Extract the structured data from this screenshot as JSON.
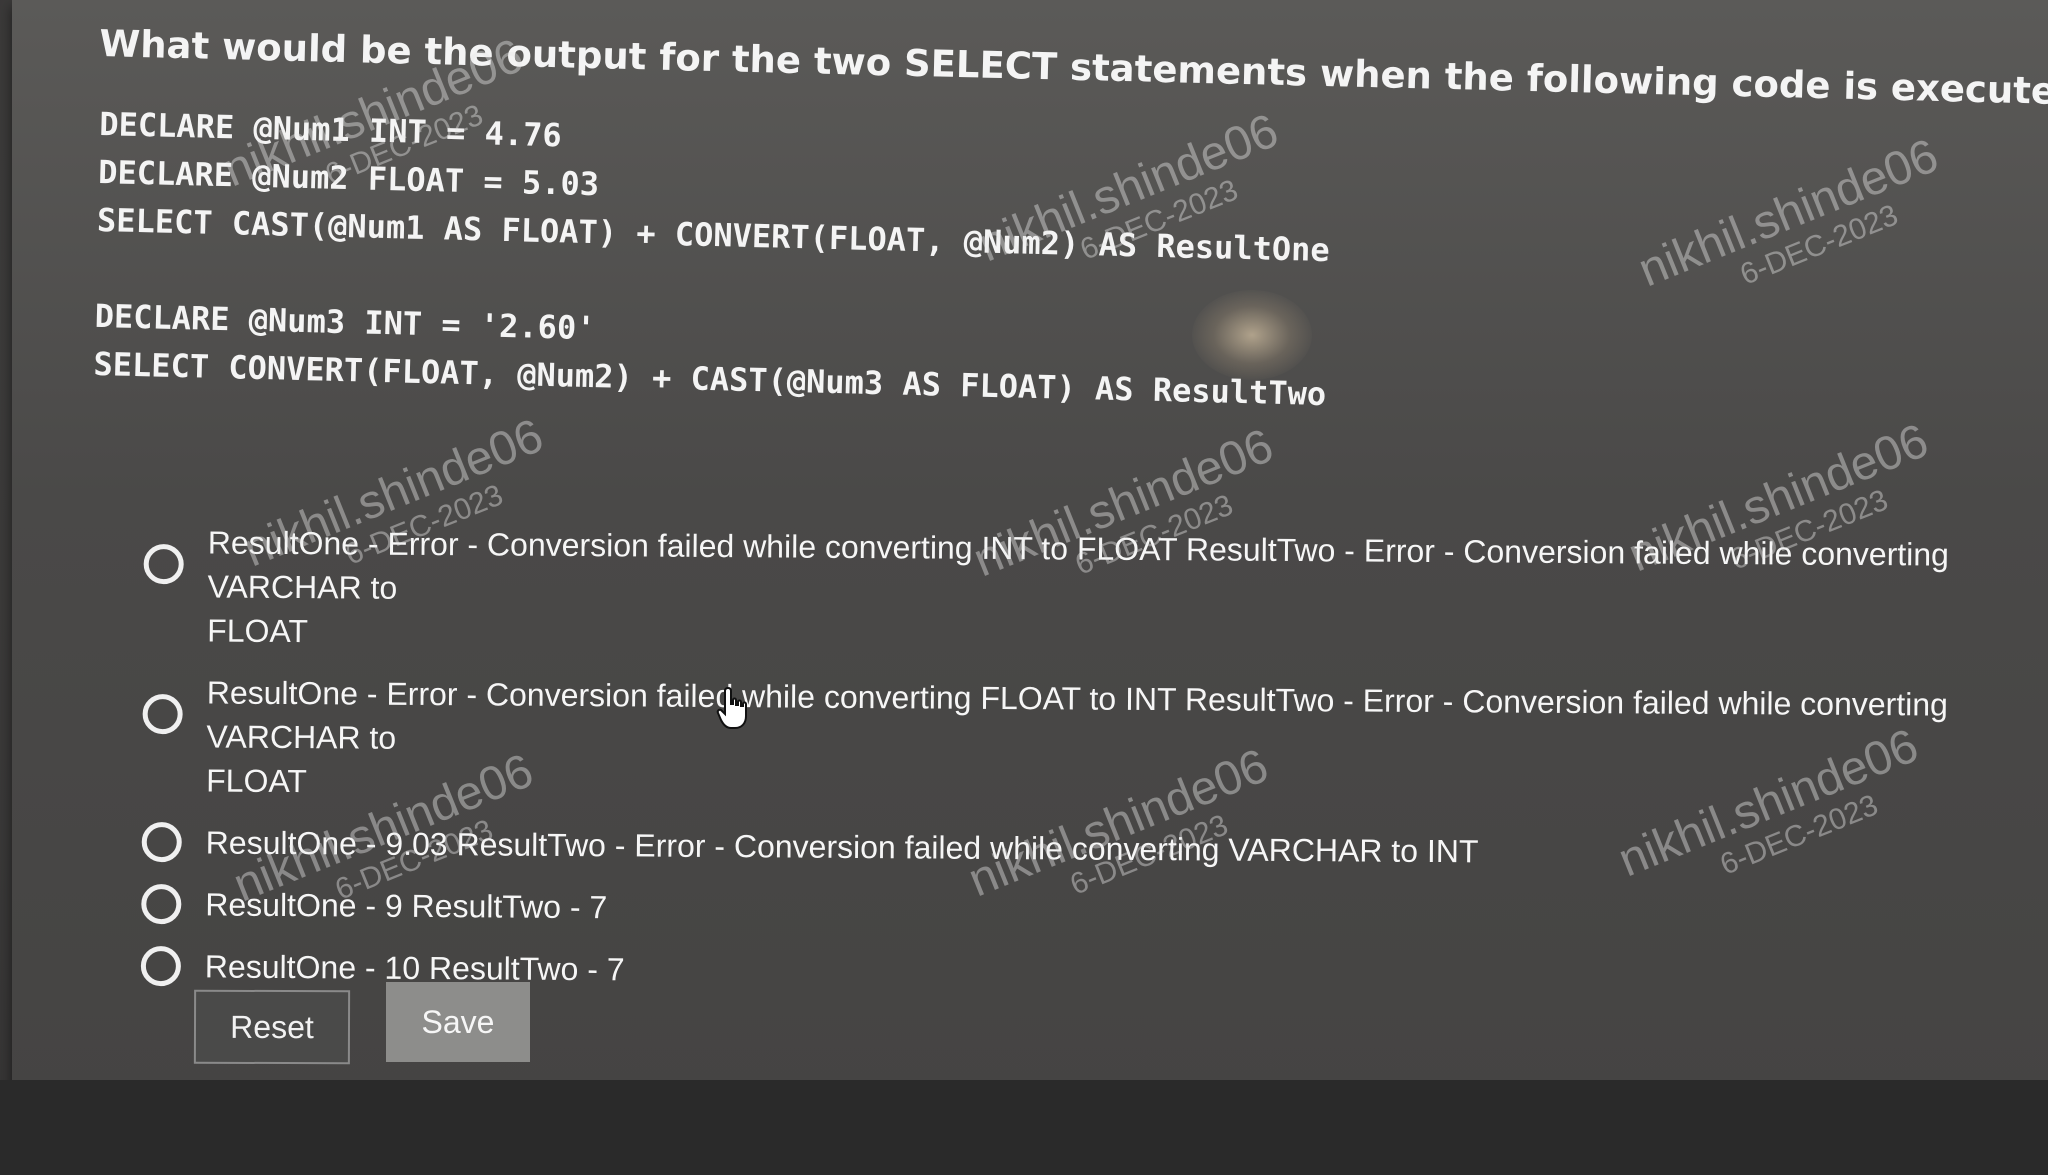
{
  "question": "What would be the output for the two SELECT statements when the following code is executed as a batch?",
  "code": {
    "block1": [
      "DECLARE @Num1 INT = 4.76",
      "DECLARE @Num2 FLOAT = 5.03",
      "SELECT CAST(@Num1 AS FLOAT) + CONVERT(FLOAT, @Num2) AS ResultOne"
    ],
    "block2": [
      "DECLARE @Num3 INT = '2.60'",
      "SELECT CONVERT(FLOAT, @Num2) + CAST(@Num3 AS FLOAT) AS ResultTwo"
    ]
  },
  "options": [
    {
      "line1": "ResultOne - Error - Conversion failed while converting INT to FLOAT ResultTwo - Error - Conversion failed while converting VARCHAR to",
      "line2": "FLOAT",
      "selected": false
    },
    {
      "line1": "ResultOne - Error - Conversion failed while converting FLOAT to INT ResultTwo - Error - Conversion failed while converting VARCHAR to",
      "line2": "FLOAT",
      "selected": false
    },
    {
      "line1": "ResultOne - 9.03 ResultTwo - Error - Conversion failed while converting VARCHAR to INT",
      "line2": "",
      "selected": false
    },
    {
      "line1": "ResultOne - 9 ResultTwo - 7",
      "line2": "",
      "selected": false
    },
    {
      "line1": "ResultOne - 10 ResultTwo - 7",
      "line2": "",
      "selected": false
    }
  ],
  "buttons": {
    "reset": "Reset",
    "save": "Save"
  },
  "watermark": {
    "name": "nikhil.shinde06",
    "date": "6-DEC-2023"
  },
  "icons": {
    "cursor": "hand-pointer-icon",
    "radio": "radio-unchecked-icon"
  }
}
